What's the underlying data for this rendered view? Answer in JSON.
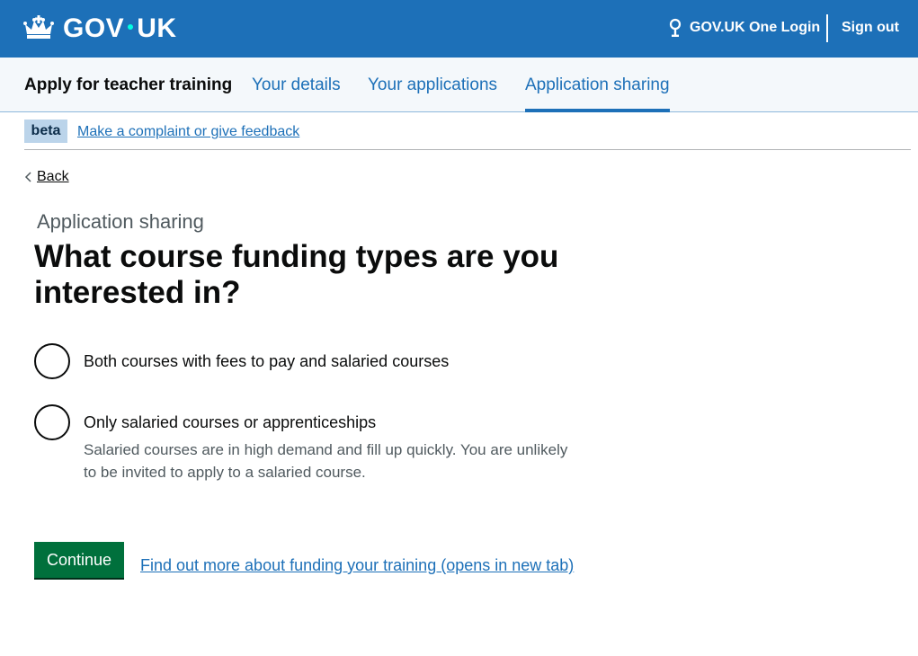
{
  "header": {
    "logo_text_left": "GOV",
    "logo_text_right": "UK",
    "crown_icon": "crown-icon",
    "one_login_label": "GOV.UK One Login",
    "sign_out_label": "Sign out",
    "background_color": "#1d70b8"
  },
  "service_nav": {
    "service_name": "Apply for teacher training",
    "items": [
      {
        "label": "Your details",
        "active": false
      },
      {
        "label": "Your applications",
        "active": false
      },
      {
        "label": "Application sharing",
        "active": true
      }
    ]
  },
  "phase_banner": {
    "tag": "beta",
    "link_text": "Make a complaint or give feedback"
  },
  "back_link": {
    "label": "Back"
  },
  "main": {
    "caption": "Application sharing",
    "heading": "What course funding types are you interested in?",
    "options": [
      {
        "label": "Both courses with fees to pay and salaried courses",
        "hint": "",
        "selected": false
      },
      {
        "label": "Only salaried courses or apprenticeships",
        "hint": "Salaried courses are in high demand and fill up quickly. You are unlikely to be invited to apply to a salaried course.",
        "selected": false
      }
    ],
    "continue_label": "Continue",
    "funding_link": "Find out more about funding your training (opens in new tab)"
  },
  "colors": {
    "link": "#1d70b8",
    "button": "#00703c",
    "beta_tag_bg": "#bbd4ea"
  }
}
